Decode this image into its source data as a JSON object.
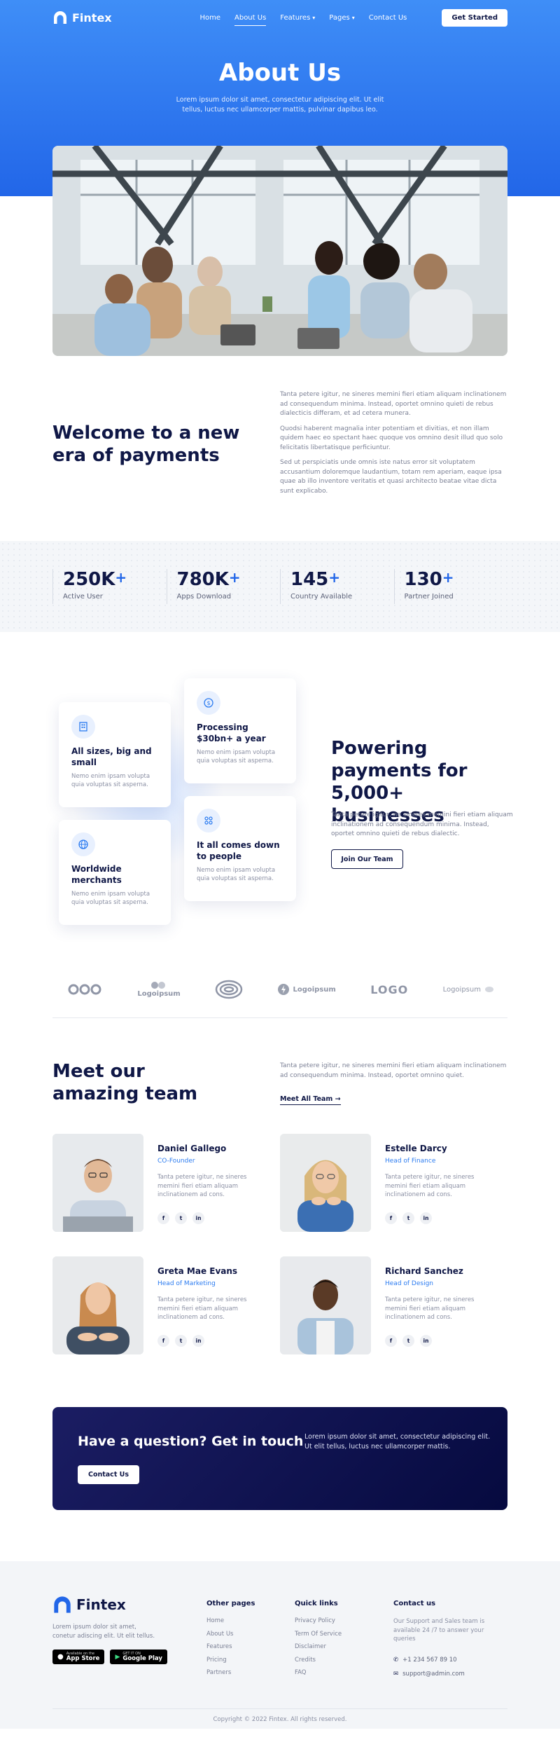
{
  "brand": {
    "name": "Fintex"
  },
  "nav": {
    "items": [
      {
        "label": "Home"
      },
      {
        "label": "About Us"
      },
      {
        "label": "Features"
      },
      {
        "label": "Pages"
      },
      {
        "label": "Contact Us"
      }
    ],
    "cta": "Get Started"
  },
  "hero": {
    "title": "About Us",
    "subtitle": "Lorem ipsum dolor sit amet, consectetur adipiscing elit. Ut elit tellus, luctus nec ullamcorper mattis, pulvinar dapibus leo."
  },
  "welcome": {
    "title": "Welcome to a new era of payments",
    "paragraphs": [
      "Tanta petere igitur, ne sineres memini fieri etiam aliquam inclinationem ad consequendum minima. Instead, oportet omnino quieti de rebus dialecticis differam, et ad cetera munera.",
      "Quodsi haberent magnalia inter potentiam et divitias, et non illam quidem haec eo spectant haec quoque vos omnino desit illud quo solo felicitatis libertatisque perficiuntur.",
      "Sed ut perspiciatis unde omnis iste natus error sit voluptatem accusantium doloremque laudantium, totam rem aperiam, eaque ipsa quae ab illo inventore veritatis et quasi architecto beatae vitae dicta sunt explicabo."
    ]
  },
  "stats": [
    {
      "value": "250K",
      "plus": "+",
      "label": "Active User"
    },
    {
      "value": "780K",
      "plus": "+",
      "label": "Apps Download"
    },
    {
      "value": "145",
      "plus": "+",
      "label": "Country Available"
    },
    {
      "value": "130",
      "plus": "+",
      "label": "Partner Joined"
    }
  ],
  "features": {
    "cards": [
      {
        "title": "All sizes, big and small",
        "text": "Nemo enim ipsam volupta quia voluptas sit asperna.",
        "icon": "building-icon"
      },
      {
        "title": "Processing $30bn+ a year",
        "text": "Nemo enim ipsam volupta quia voluptas sit asperna.",
        "icon": "dollar-coin-icon"
      },
      {
        "title": "Worldwide merchants",
        "text": "Nemo enim ipsam volupta quia voluptas sit asperna.",
        "icon": "globe-icon"
      },
      {
        "title": "It all comes down to people",
        "text": "Nemo enim ipsam volupta quia voluptas sit asperna.",
        "icon": "people-icon"
      }
    ],
    "title": "Powering payments for 5,000+ businesses",
    "text": "Tanta petere igitur, ne sineres memini fieri etiam aliquam inclinationem ad consequendum minima. Instead, oportet omnino quieti de rebus dialectic.",
    "button": "Join Our Team"
  },
  "logos": [
    "Logoipsum",
    "Logoipsum",
    "LOGO",
    "Logoipsum"
  ],
  "team": {
    "title": "Meet our amazing team",
    "intro": "Tanta petere igitur, ne sineres memini fieri etiam aliquam inclinationem ad consequendum minima. Instead, oportet omnino quiet.",
    "link": "Meet All Team",
    "members": [
      {
        "name": "Daniel Gallego",
        "role": "CO-Founder",
        "bio": "Tanta petere igitur, ne sineres memini fieri etiam aliquam inclinationem ad cons."
      },
      {
        "name": "Estelle Darcy",
        "role": "Head of Finance",
        "bio": "Tanta petere igitur, ne sineres memini fieri etiam aliquam inclinationem ad cons."
      },
      {
        "name": "Greta Mae Evans",
        "role": "Head of Marketing",
        "bio": "Tanta petere igitur, ne sineres memini fieri etiam aliquam inclinationem ad cons."
      },
      {
        "name": "Richard Sanchez",
        "role": "Head of Design",
        "bio": "Tanta petere igitur, ne sineres memini fieri etiam aliquam inclinationem ad cons."
      }
    ],
    "socials": [
      "f",
      "t",
      "in"
    ]
  },
  "cta": {
    "title": "Have a question? Get in touch",
    "text": "Lorem ipsum dolor sit amet, consectetur adipiscing elit. Ut elit tellus, luctus nec ullamcorper mattis.",
    "button": "Contact Us"
  },
  "footer": {
    "about": "Lorem ipsum dolor sit amet, conetur adiscing elit. Ut elit tellus.",
    "stores": [
      {
        "small": "Available on the",
        "big": "App Store"
      },
      {
        "small": "GET IT ON",
        "big": "Google Play"
      }
    ],
    "other_pages": {
      "title": "Other pages",
      "links": [
        "Home",
        "About Us",
        "Features",
        "Pricing",
        "Partners"
      ]
    },
    "quick_links": {
      "title": "Quick links",
      "links": [
        "Privacy Policy",
        "Term Of Service",
        "Disclaimer",
        "Credits",
        "FAQ"
      ]
    },
    "contact": {
      "title": "Contact us",
      "text": "Our Support and Sales team is available 24 /7 to answer your queries",
      "phone": "+1 234 567 89 10",
      "email": "support@admin.com"
    },
    "copyright": "Copyright © 2022 Fintex. All rights reserved."
  },
  "colors": {
    "primary": "#2266e8",
    "navy": "#0f1746",
    "cta_bg": "#0b0f4a"
  }
}
